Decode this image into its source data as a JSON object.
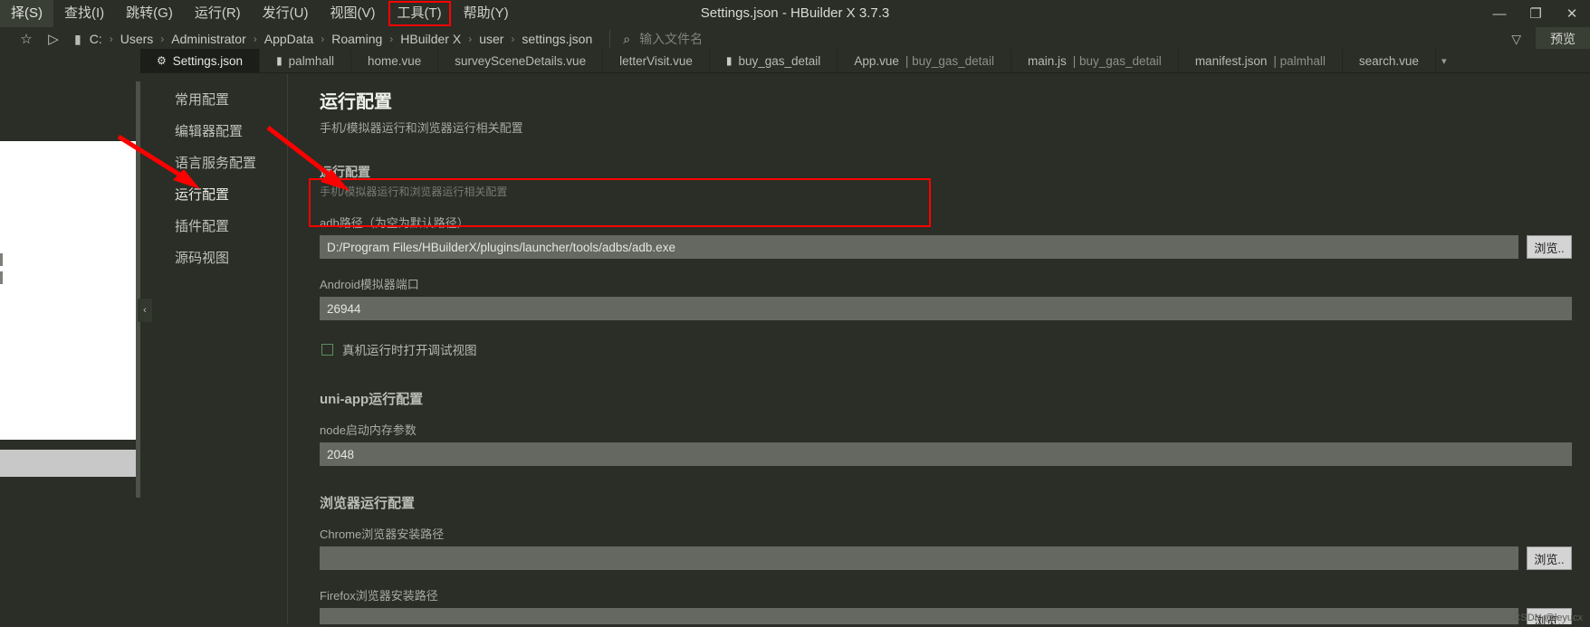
{
  "window": {
    "title": "Settings.json - HBuilder X 3.7.3",
    "minimize_label": "—",
    "maximize_label": "❐",
    "close_label": "✕"
  },
  "menu": {
    "items": [
      {
        "label": "择(S)",
        "active": true,
        "boxed": false
      },
      {
        "label": "查找(I)",
        "active": false,
        "boxed": false
      },
      {
        "label": "跳转(G)",
        "active": false,
        "boxed": false
      },
      {
        "label": "运行(R)",
        "active": false,
        "boxed": false
      },
      {
        "label": "发行(U)",
        "active": false,
        "boxed": false
      },
      {
        "label": "视图(V)",
        "active": false,
        "boxed": false
      },
      {
        "label": "工具(T)",
        "active": false,
        "boxed": true
      },
      {
        "label": "帮助(Y)",
        "active": false,
        "boxed": false
      }
    ]
  },
  "pathbar": {
    "star_icon": "☆",
    "run_icon": "▷",
    "folder_icon": "▮",
    "crumbs": [
      "C:",
      "Users",
      "Administrator",
      "AppData",
      "Roaming",
      "HBuilder X",
      "user",
      "settings.json"
    ],
    "separator": "›",
    "search_icon": "⌕",
    "search_placeholder": "输入文件名",
    "filter_icon": "▽",
    "preview_label": "预览"
  },
  "tabs": [
    {
      "label": "Settings.json",
      "icon": "⚙",
      "active": true,
      "dim": ""
    },
    {
      "label": "palmhall",
      "icon": "▮",
      "active": false,
      "dim": ""
    },
    {
      "label": "home.vue",
      "icon": "",
      "active": false,
      "dim": ""
    },
    {
      "label": "surveySceneDetails.vue",
      "icon": "",
      "active": false,
      "dim": ""
    },
    {
      "label": "letterVisit.vue",
      "icon": "",
      "active": false,
      "dim": ""
    },
    {
      "label": "buy_gas_detail",
      "icon": "▮",
      "active": false,
      "dim": ""
    },
    {
      "label": "App.vue",
      "icon": "",
      "active": false,
      "dim": "| buy_gas_detail"
    },
    {
      "label": "main.js",
      "icon": "",
      "active": false,
      "dim": "| buy_gas_detail"
    },
    {
      "label": "manifest.json",
      "icon": "",
      "active": false,
      "dim": "| palmhall"
    },
    {
      "label": "search.vue",
      "icon": "",
      "active": false,
      "dim": ""
    }
  ],
  "tab_overflow_icon": "▾",
  "sidenav": {
    "items": [
      {
        "label": "常用配置",
        "selected": false
      },
      {
        "label": "编辑器配置",
        "selected": false
      },
      {
        "label": "语言服务配置",
        "selected": false
      },
      {
        "label": "运行配置",
        "selected": true
      },
      {
        "label": "插件配置",
        "selected": false
      },
      {
        "label": "源码视图",
        "selected": false
      }
    ]
  },
  "collapse_handle_icon": "‹",
  "content": {
    "page_title": "运行配置",
    "page_subtitle": "手机/模拟器运行和浏览器运行相关配置",
    "section_title": "运行配置",
    "section_subtitle": "手机/模拟器运行和浏览器运行相关配置",
    "fields": [
      {
        "label": "adb路径（为空为默认路径）",
        "value": "D:/Program Files/HBuilderX/plugins/launcher/tools/adbs/adb.exe",
        "has_browse": true,
        "browse_label": "浏览.."
      },
      {
        "label": "Android模拟器端口",
        "value": "26944",
        "has_browse": false,
        "browse_label": ""
      }
    ],
    "checkbox": {
      "label": "真机运行时打开调试视图",
      "checked": false
    },
    "uniapp_group_title": "uni-app运行配置",
    "node_field": {
      "label": "node启动内存参数",
      "value": "2048"
    },
    "browser_group_title": "浏览器运行配置",
    "chrome_field": {
      "label": "Chrome浏览器安装路径",
      "value": "",
      "browse_label": "浏览.."
    },
    "firefox_field": {
      "label": "Firefox浏览器安装路径",
      "value": "",
      "browse_label": "浏览.."
    }
  },
  "watermark": "CSDN @leyucx",
  "colors": {
    "background": "#2a2e27",
    "input_bg": "#646861",
    "annotation_red": "#ff0000",
    "accent_checkbox": "#5e8f5e"
  }
}
